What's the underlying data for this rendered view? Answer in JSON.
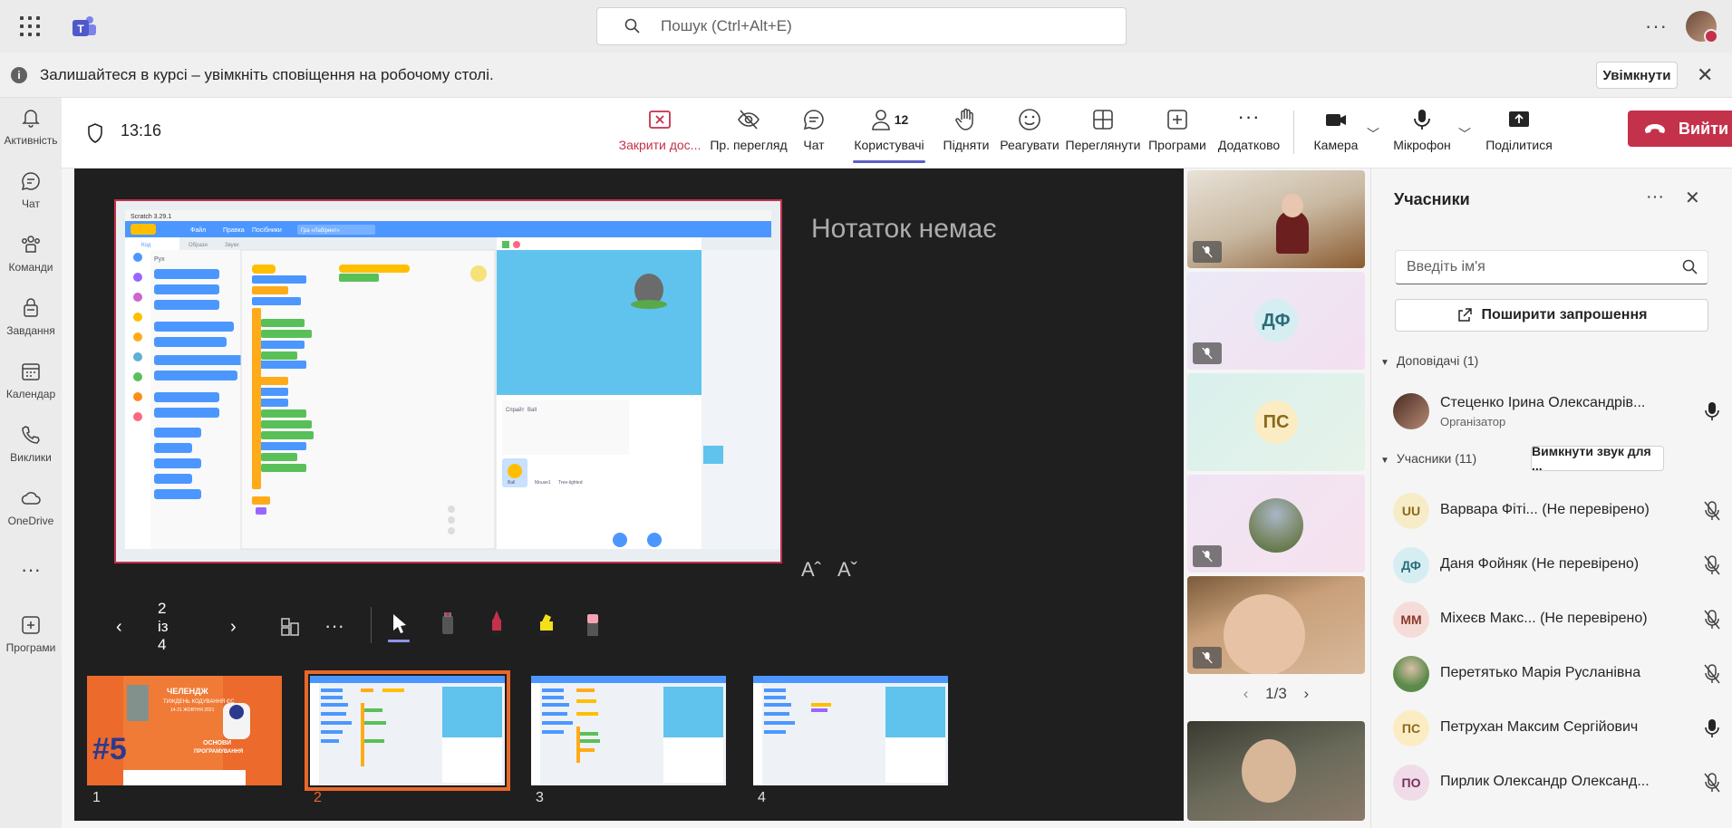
{
  "search": {
    "placeholder": "Пошук (Ctrl+Alt+E)"
  },
  "notification": {
    "message": "Залишайтеся в курсі – увімкніть сповіщення на робочому столі.",
    "enable_label": "Увімкнути"
  },
  "rail": [
    {
      "label": "Активність",
      "icon": "bell-icon"
    },
    {
      "label": "Чат",
      "icon": "chat-icon"
    },
    {
      "label": "Команди",
      "icon": "teams-icon"
    },
    {
      "label": "Завдання",
      "icon": "assignments-icon"
    },
    {
      "label": "Календар",
      "icon": "calendar-icon"
    },
    {
      "label": "Виклики",
      "icon": "phone-icon"
    },
    {
      "label": "OneDrive",
      "icon": "cloud-icon"
    },
    {
      "label": "Програми",
      "icon": "apps-add-icon"
    }
  ],
  "meeting": {
    "time": "13:16",
    "toolbar": {
      "stop_share": "Закрити дос...",
      "private_view": "Пр. перегляд",
      "chat": "Чат",
      "people": "Користувачі",
      "people_count": "12",
      "raise": "Підняти",
      "react": "Реагувати",
      "view": "Переглянути",
      "apps": "Програми",
      "more": "Додатково",
      "camera": "Камера",
      "mic": "Мікрофон",
      "share": "Поділитися",
      "leave": "Вийти"
    }
  },
  "stage": {
    "notes": "Нотаток немає",
    "font_increase": "Aˆ",
    "font_decrease": "Aˇ",
    "slide_counter": "2 із 4",
    "thumbnails": [
      "1",
      "2",
      "3",
      "4"
    ],
    "selected_thumbnail": 2,
    "slide1_text": {
      "challenge": "ЧЕЛЕНДЖ",
      "week": "ТИЖДЕНЬ КОДУВАННЯ ЄС",
      "dates": "14-21 ЖОВТНЯ 2021",
      "topic1": "ОСНОВИ",
      "topic2": "ПРОГРАМУВАННЯ",
      "number": "#5"
    },
    "scratch": {
      "title": "Scratch 3.29.1",
      "menu_file": "Файл",
      "menu_edit": "Правка",
      "menu_tutorials": "Посібники",
      "project": "Гра «Лабіринт»",
      "tab_code": "Код",
      "tab_costumes": "Образи",
      "tab_sounds": "Звуки",
      "category": "Рух",
      "sprite_label": "Спрайт",
      "sprite_name": "Ball",
      "sprites": [
        "Ball",
        "Mouse1",
        "Tree-lighted"
      ]
    }
  },
  "video": {
    "pager": "1/3",
    "tiles": [
      "",
      "ДФ",
      "ПС",
      "",
      "",
      ""
    ]
  },
  "participants": {
    "title": "Учасники",
    "search_placeholder": "Введіть ім'я",
    "share_invite": "Поширити запрошення",
    "presenters_header": "Доповідачі (1)",
    "attendees_header": "Учасники (11)",
    "mute_all": "Вимкнути звук для ...",
    "presenter": {
      "name": "Стеценко Ірина Олександрів...",
      "role": "Організатор"
    },
    "list": [
      {
        "initials": "UU",
        "name": "Варвара Фіті...  (Не перевірено)",
        "bg": "#f6ecc8",
        "fg": "#8a6a1a"
      },
      {
        "initials": "ДФ",
        "name": "Даня Фойняк (Не перевірено)",
        "bg": "#d6eef2",
        "fg": "#2b6c7a"
      },
      {
        "initials": "ММ",
        "name": "Міхеєв Макс...  (Не перевірено)",
        "bg": "#f6dcd8",
        "fg": "#8b3a2e"
      },
      {
        "initials": "",
        "name": "Перетятько Марія Русланівна",
        "bg": "#5c8a4a",
        "fg": "#fff"
      },
      {
        "initials": "ПС",
        "name": "Петрухан Максим Сергійович",
        "bg": "#fbecc4",
        "fg": "#8a6a1a"
      },
      {
        "initials": "ПО",
        "name": "Пирлик Олександр Олександ...",
        "bg": "#f0dce8",
        "fg": "#7a2e5a"
      }
    ]
  }
}
